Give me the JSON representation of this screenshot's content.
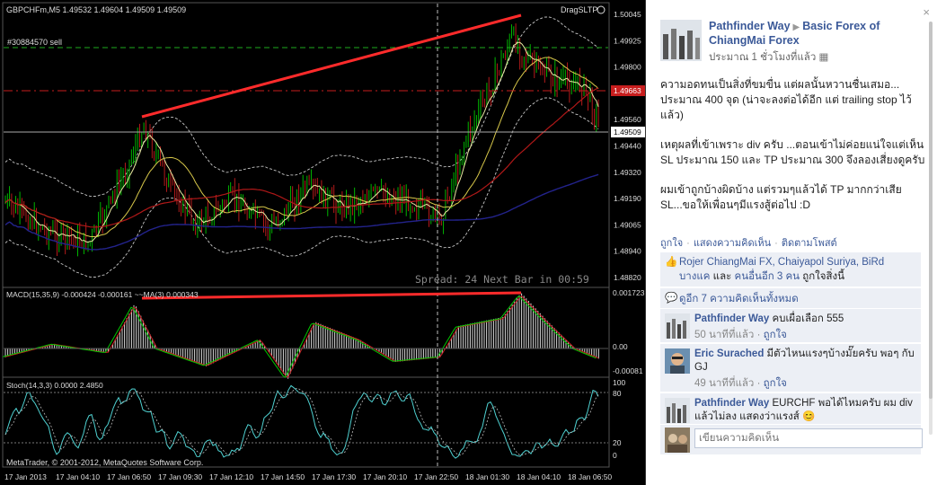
{
  "chart": {
    "symbol_info": "GBPCHFm,M5  1.49532 1.49604 1.49509 1.49509",
    "order_label": "#30884570 sell",
    "drag_label": "DragSLTP",
    "spread_text": "Spread: 24   Next Bar in 00:59",
    "copyright": "MetaTrader, © 2001-2012, MetaQuotes Software Corp.",
    "price_labels": [
      "1.50045",
      "1.49925",
      "1.49800",
      "1.49680",
      "1.49560",
      "1.49440",
      "1.49320",
      "1.49190",
      "1.49065",
      "1.48940",
      "1.48820"
    ],
    "sl_price": "1.49663",
    "current_price": "1.49509",
    "macd_label": "MACD(15,35,9) -0.000424 -0.000161 ~~MA(3) 0.000343",
    "macd_scale": [
      "0.001723",
      "0.00",
      "-0.00081"
    ],
    "stoch_label": "Stoch(14,3,3) 0.0000 2.4850",
    "stoch_scale": [
      "100",
      "80",
      "20",
      "0"
    ],
    "time_labels": [
      "17 Jan 2013",
      "17 Jan 04:10",
      "17 Jan 06:50",
      "17 Jan 09:30",
      "17 Jan 12:10",
      "17 Jan 14:50",
      "17 Jan 17:30",
      "17 Jan 20:10",
      "17 Jan 22:50",
      "18 Jan 01:30",
      "18 Jan 04:10",
      "18 Jan 06:50"
    ],
    "colors": {
      "bull": "#00c800",
      "bear": "#c81e1e",
      "trend": "#ff2b2b",
      "bands": "#c8c8c8",
      "ma_slow": "#23238c",
      "stoch": "#4fd2d2"
    }
  },
  "panel": {
    "close_icon": "×",
    "author": "Pathfinder Way",
    "group": "Basic Forex of ChiangMai Forex",
    "time": "ประมาณ 1 ชั่วโมงที่แล้ว",
    "post_paragraphs": [
      "ความอดทนเป็นสิ่งที่ขมขื่น แต่ผลนั้นหวานชื่นเสมอ... ประมาณ 400 จุด (น่าจะลงต่อได้อีก แต่ trailing stop ไว้แล้ว)",
      "เหตุผลที่เข้าเพราะ div ครับ ...ตอนเข้าไม่ค่อยแน่ใจแต่เห็น SL ประมาณ 150 และ TP ประมาณ 300 จึงลองเสี่ยงดูครับ",
      "ผมเข้าถูกบ้างผิดบ้าง แต่รวมๆแล้วได้ TP มากกว่าเสีย SL...ขอให้เพื่อนๆมีแรงสู้ต่อไป :D"
    ],
    "actions": [
      "ถูกใจ",
      "แสดงความคิดเห็น",
      "ติดตามโพสต์"
    ],
    "likes_names": "Rojer ChiangMai FX, Chaiyapol Suriya, BiRd บางแค",
    "likes_and": " และ ",
    "likes_others": "คนอื่นอีก 3 คน",
    "likes_suffix": " ถูกใจสิ่งนี้",
    "view_all": "ดูอีก 7 ความคิดเห็นทั้งหมด",
    "comments": [
      {
        "name": "Pathfinder Way",
        "text": "คบเผื่อเลือก 555",
        "time": "50 นาทีที่แล้ว",
        "like": "ถูกใจ"
      },
      {
        "name": "Eric Surached",
        "text": "มีตัวไหนแรงๆบ้างมั๊ยครับ พอๆ กับ GJ",
        "time": "49 นาทีที่แล้ว",
        "like": "ถูกใจ"
      },
      {
        "name": "Pathfinder Way",
        "text": "EURCHF พอได้ไหมครับ ผม div แล้วไม่ลง แสดงว่าแรงส์ 😊",
        "time": "",
        "like": ""
      }
    ],
    "comment_placeholder": "เขียนความคิดเห็น"
  }
}
